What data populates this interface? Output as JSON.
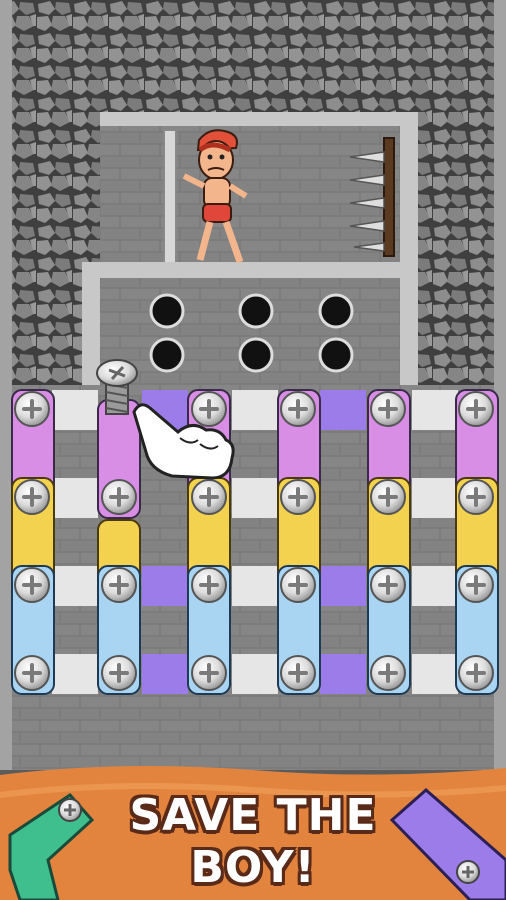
{
  "banner": {
    "line1": "SAVE THE",
    "line2": "BOY!"
  },
  "icons": {
    "character": "boy-in-red-cap-icon",
    "hazard": "spike-wall-icon",
    "screw": "screw-head-icon",
    "hand": "pointing-hand-icon",
    "plank": "wooden-plank-icon"
  },
  "colors": {
    "stone_bg": "#5b5b5b",
    "wall": "#7a7a7a",
    "frame": "#c8c8c8",
    "plank_pink": "#d98ee6",
    "plank_yellow": "#f2d24e",
    "plank_blue": "#a9d5f2",
    "plank_purple": "#9b7ce8",
    "banner_orange": "#e2843e",
    "plank_green": "#3fbf8e"
  }
}
